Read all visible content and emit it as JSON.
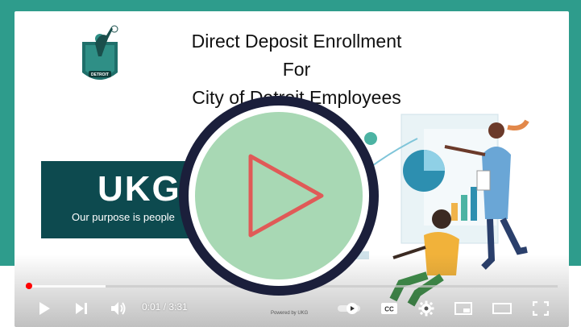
{
  "slide": {
    "title_line1": "Direct Deposit Enrollment",
    "title_line2": "For",
    "title_line3": "City of Detroit Employees",
    "logo_text": "CITY OF DETROIT",
    "ukg_wordmark": "UKG",
    "ukg_tagline": "Our purpose is people"
  },
  "player": {
    "current_time": "0:01",
    "duration": "3:31",
    "time_display": "0:01 / 3:31",
    "played_fraction": 0.005,
    "buffered_fraction": 0.15,
    "powered_by": "Powered by UKG"
  },
  "icons": {
    "play": "play-icon",
    "next": "next-icon",
    "volume": "volume-icon",
    "autoplay": "autoplay-toggle-icon",
    "captions": "captions-icon",
    "settings": "gear-icon",
    "miniplayer": "miniplayer-icon",
    "theater": "theater-mode-icon",
    "fullscreen": "fullscreen-icon",
    "big_play": "play-overlay-icon"
  },
  "colors": {
    "frame_teal": "#2e9c8c",
    "banner_teal": "#0d4a4f",
    "progress_red": "#ff0000",
    "play_circle_fill": "#a8d8b4",
    "play_circle_ring": "#1b1f3b",
    "play_triangle": "#e05a57"
  }
}
